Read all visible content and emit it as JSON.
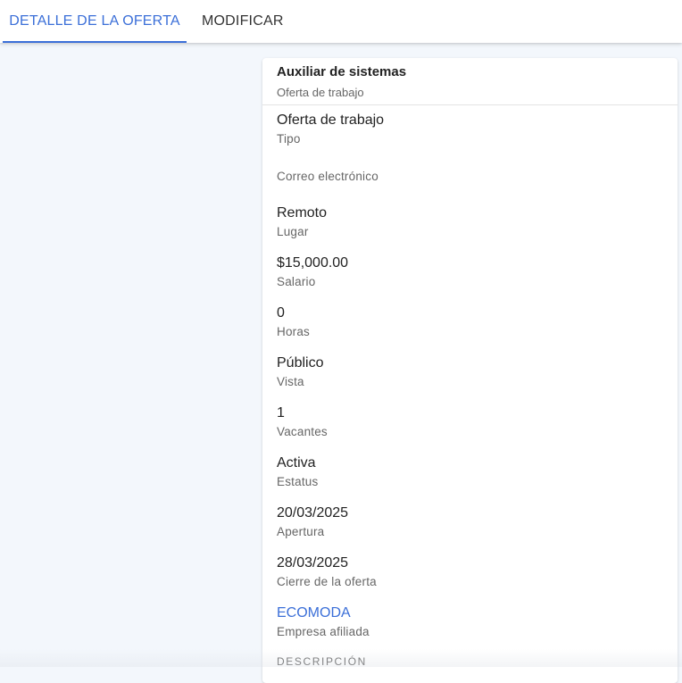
{
  "tabs": {
    "detail_label": "DETALLE DE LA OFERTA",
    "modify_label": "MODIFICAR"
  },
  "offer": {
    "title": "Auxiliar de sistemas",
    "subtitle": "Oferta de trabajo",
    "fields": [
      {
        "value": "Oferta de trabajo",
        "label": "Tipo"
      },
      {
        "value": "",
        "label": "Correo electrónico"
      },
      {
        "value": "Remoto",
        "label": "Lugar"
      },
      {
        "value": "$15,000.00",
        "label": "Salario"
      },
      {
        "value": "0",
        "label": "Horas"
      },
      {
        "value": "Público",
        "label": "Vista"
      },
      {
        "value": "1",
        "label": "Vacantes"
      },
      {
        "value": "Activa",
        "label": "Estatus"
      },
      {
        "value": "20/03/2025",
        "label": "Apertura"
      },
      {
        "value": "28/03/2025",
        "label": "Cierre de la oferta"
      },
      {
        "value": "ECOMODA",
        "label": "Empresa afiliada"
      }
    ],
    "description_title": "DESCRIPCIÓN"
  },
  "colors": {
    "accent": "#3b6fd8",
    "background": "#f3f7fc"
  }
}
